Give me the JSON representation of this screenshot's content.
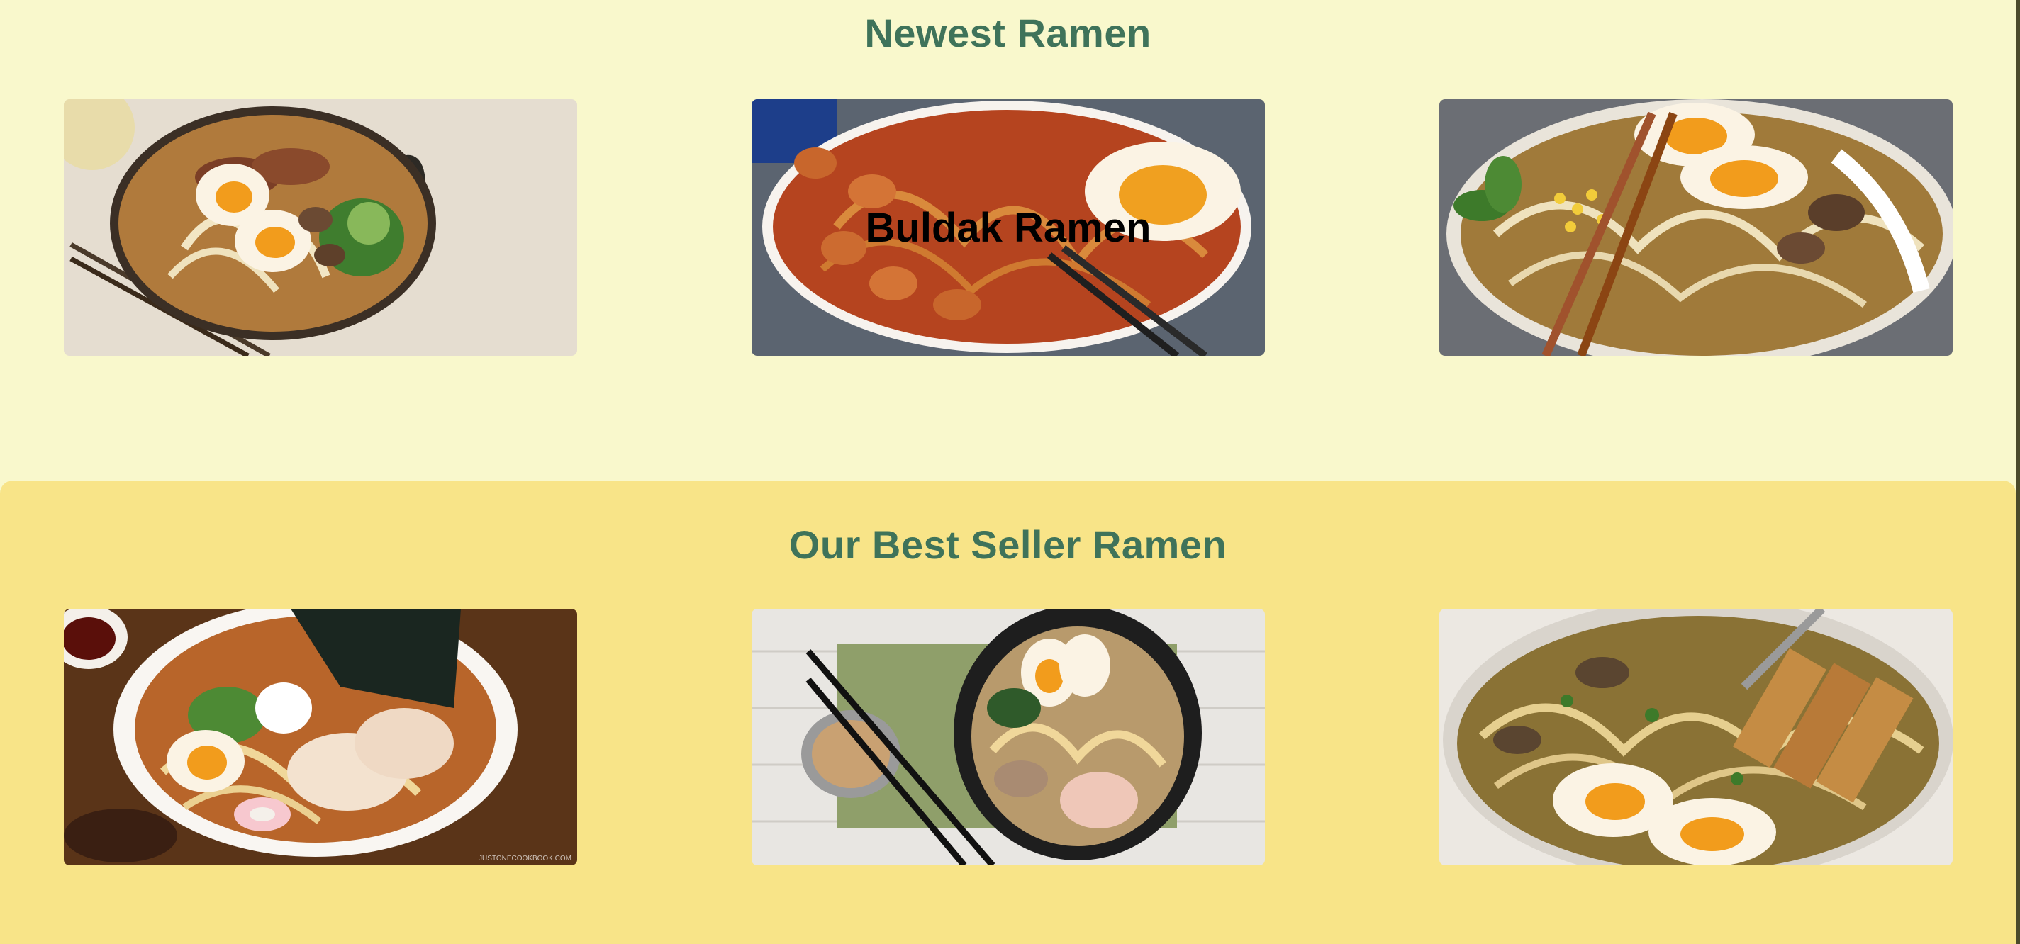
{
  "sections": {
    "newest": {
      "title": "Newest Ramen",
      "cards": [
        {
          "overlay_label": "",
          "image": "tonkotsu-ramen-photo"
        },
        {
          "overlay_label": "Buldak Ramen",
          "image": "buldak-ramen-photo"
        },
        {
          "overlay_label": "",
          "image": "mushroom-corn-ramen-photo"
        }
      ]
    },
    "best_seller": {
      "title": "Our Best Seller Ramen",
      "cards": [
        {
          "overlay_label": "",
          "image": "shoyu-ramen-photo",
          "watermark": "JUSTONECOOKBOOK.COM"
        },
        {
          "overlay_label": "",
          "image": "miso-ramen-photo"
        },
        {
          "overlay_label": "",
          "image": "chicken-curry-ramen-photo"
        }
      ]
    }
  },
  "colors": {
    "page_background": "#f9f8cc",
    "best_seller_background": "#f8e488",
    "heading_color": "#3f735a"
  }
}
